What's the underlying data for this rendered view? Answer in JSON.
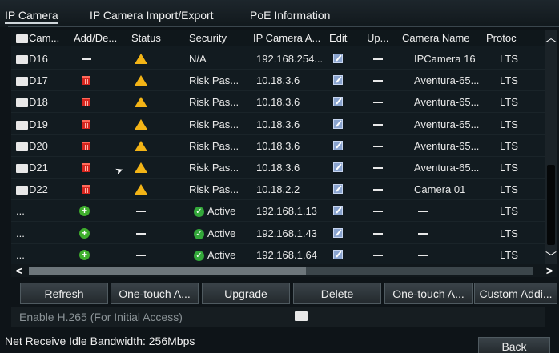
{
  "tabs": [
    {
      "label": "IP Camera"
    },
    {
      "label": "IP Camera Import/Export"
    },
    {
      "label": "PoE Information"
    }
  ],
  "table": {
    "headers": {
      "camera": "Cam...",
      "add_delete": "Add/De...",
      "status": "Status",
      "security": "Security",
      "ip_address": "IP Camera A...",
      "edit": "Edit",
      "upgrade": "Up...",
      "camera_name": "Camera Name",
      "protocol": "Protoc"
    },
    "rows": [
      {
        "cam": "D16",
        "action": "none",
        "status": "warning",
        "security": "N/A",
        "ip": "192.168.254...",
        "name": "IPCamera 16",
        "protocol": "LTS"
      },
      {
        "cam": "D17",
        "action": "delete",
        "status": "warning",
        "security": "Risk Pas...",
        "ip": "10.18.3.6",
        "name": "Aventura-65...",
        "protocol": "LTS"
      },
      {
        "cam": "D18",
        "action": "delete",
        "status": "warning",
        "security": "Risk Pas...",
        "ip": "10.18.3.6",
        "name": "Aventura-65...",
        "protocol": "LTS"
      },
      {
        "cam": "D19",
        "action": "delete",
        "status": "warning",
        "security": "Risk Pas...",
        "ip": "10.18.3.6",
        "name": "Aventura-65...",
        "protocol": "LTS"
      },
      {
        "cam": "D20",
        "action": "delete",
        "status": "warning",
        "security": "Risk Pas...",
        "ip": "10.18.3.6",
        "name": "Aventura-65...",
        "protocol": "LTS"
      },
      {
        "cam": "D21",
        "action": "delete",
        "status": "warning",
        "security": "Risk Pas...",
        "ip": "10.18.3.6",
        "name": "Aventura-65...",
        "protocol": "LTS"
      },
      {
        "cam": "D22",
        "action": "delete",
        "status": "warning",
        "security": "Risk Pas...",
        "ip": "10.18.2.2",
        "name": "Camera 01",
        "protocol": "LTS"
      },
      {
        "cam": "...",
        "action": "add",
        "status": "none",
        "security": "Active",
        "ip": "192.168.1.13",
        "name": "",
        "protocol": "LTS"
      },
      {
        "cam": "...",
        "action": "add",
        "status": "none",
        "security": "Active",
        "ip": "192.168.1.43",
        "name": "",
        "protocol": "LTS"
      },
      {
        "cam": "...",
        "action": "add",
        "status": "none",
        "security": "Active",
        "ip": "192.168.1.64",
        "name": "",
        "protocol": "LTS"
      }
    ]
  },
  "buttons": {
    "refresh": "Refresh",
    "one_touch_1": "One-touch A...",
    "upgrade": "Upgrade",
    "delete": "Delete",
    "one_touch_2": "One-touch A...",
    "custom_add": "Custom Addi..."
  },
  "enable_h265": {
    "label": "Enable H.265 (For Initial Access)",
    "checked": false
  },
  "bandwidth": "Net Receive Idle Bandwidth: 256Mbps",
  "back": "Back",
  "colors": {
    "warning": "#f3b416",
    "delete": "#d7261f",
    "add": "#3fae2d",
    "active": "#33a83a"
  }
}
